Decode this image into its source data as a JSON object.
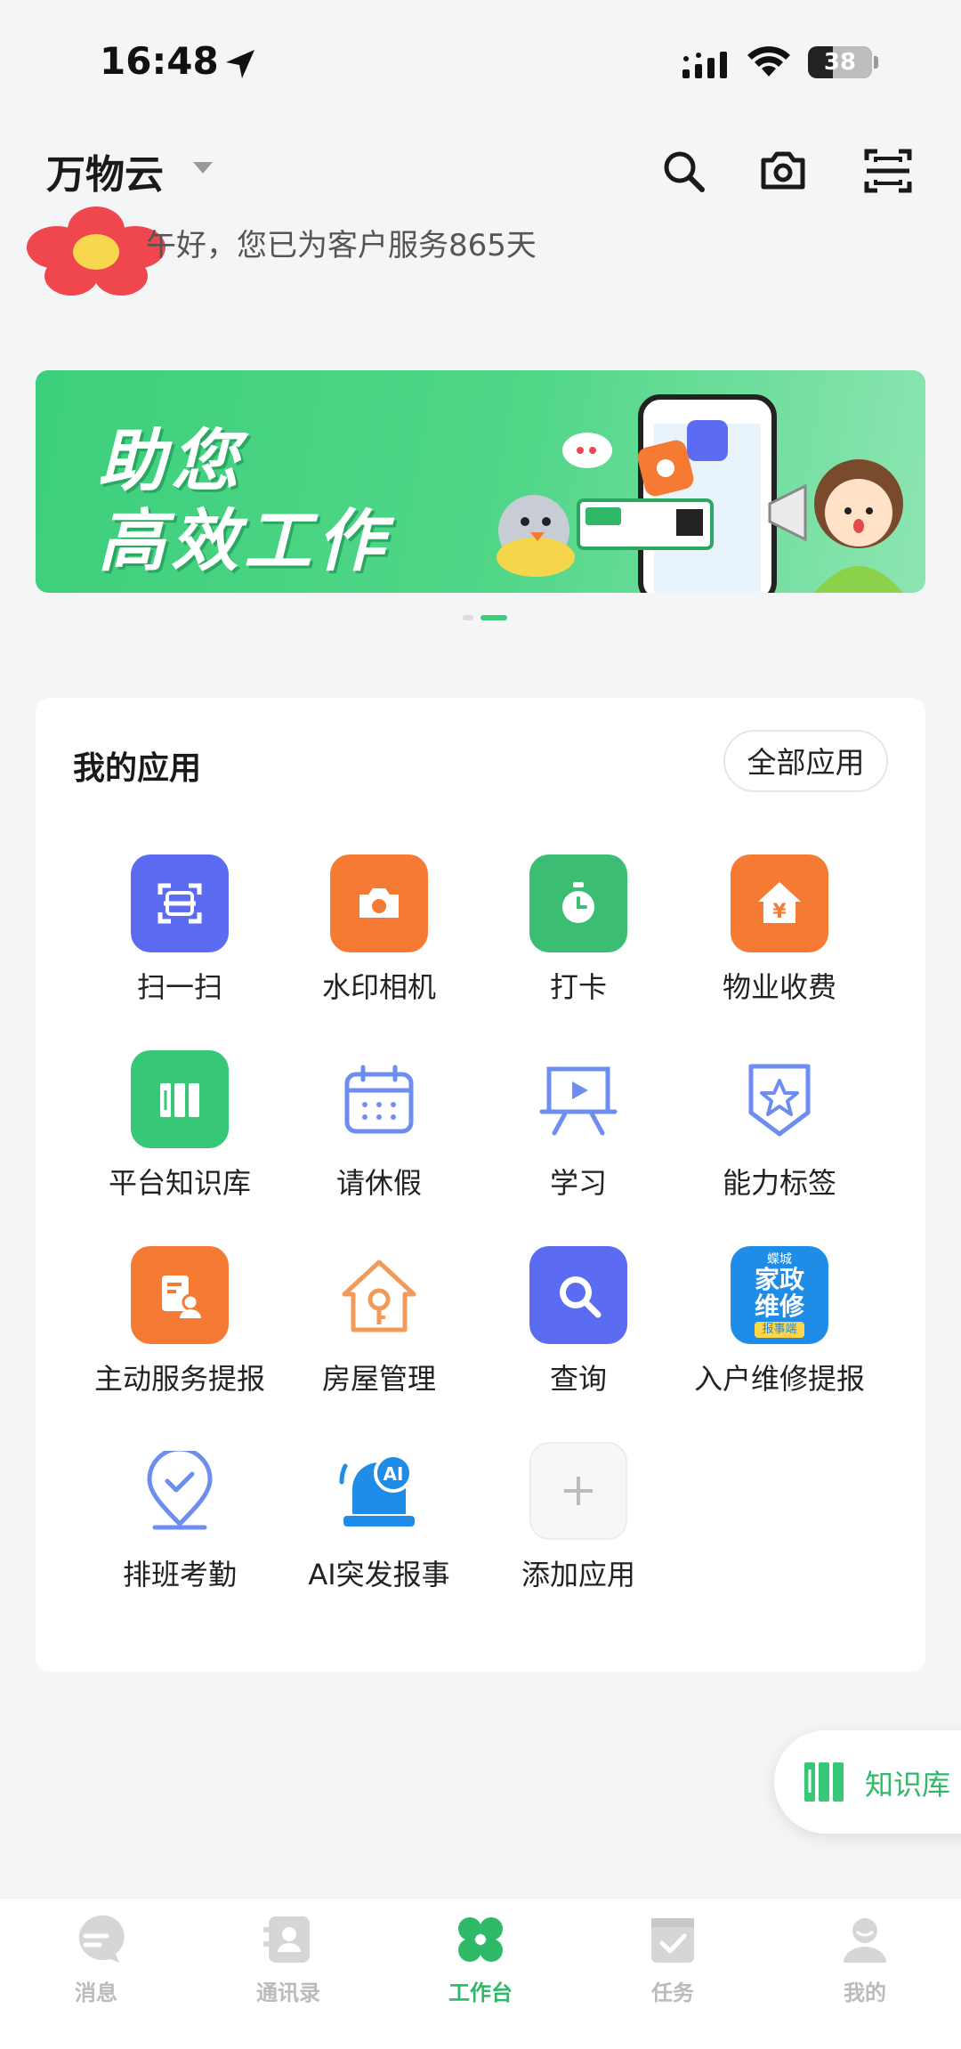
{
  "status_bar": {
    "time": "16:48",
    "battery": "38",
    "icons": [
      "location-arrow-icon",
      "signal-icon",
      "wifi-icon",
      "battery-icon"
    ]
  },
  "header": {
    "org_name": "万物云",
    "greeting": "午好，您已为客户服务865天",
    "icons": [
      "search-icon",
      "camera-icon",
      "scan-icon"
    ]
  },
  "banner": {
    "line1": "助您",
    "line2": "高效工作",
    "page_count": 2,
    "active_page": 2
  },
  "apps": {
    "title": "我的应用",
    "all_apps_label": "全部应用",
    "items": [
      {
        "label": "扫一扫",
        "icon": "scan-icon",
        "color": "#5b6cf2"
      },
      {
        "label": "水印相机",
        "icon": "camera-icon",
        "color": "#f57a33"
      },
      {
        "label": "打卡",
        "icon": "stopwatch-icon",
        "color": "#3cbd74"
      },
      {
        "label": "物业收费",
        "icon": "house-yen-icon",
        "color": "#f57a33"
      },
      {
        "label": "平台知识库",
        "icon": "books-icon",
        "color": "#36c777"
      },
      {
        "label": "请休假",
        "icon": "calendar-icon",
        "color": "#6d8ef0"
      },
      {
        "label": "学习",
        "icon": "presentation-board-icon",
        "color": "#6d8ef0"
      },
      {
        "label": "能力标签",
        "icon": "badge-star-icon",
        "color": "#6d8ef0"
      },
      {
        "label": "主动服务提报",
        "icon": "report-person-icon",
        "color": "#f57a33"
      },
      {
        "label": "房屋管理",
        "icon": "house-key-icon",
        "color": "#f19a5a"
      },
      {
        "label": "查询",
        "icon": "magnifier-icon",
        "color": "#5b6cf2"
      },
      {
        "label": "入户维修提报",
        "icon": "home-repair-icon",
        "color": "#1f8de8"
      },
      {
        "label": "排班考勤",
        "icon": "location-check-icon",
        "color": "#6d8ef0"
      },
      {
        "label": "AI突发报事",
        "icon": "ai-alarm-bell-icon",
        "color": "#1f8de8"
      },
      {
        "label": "添加应用",
        "icon": "plus-icon",
        "color": "#bbbbbb"
      }
    ],
    "home_repair_badge": {
      "top": "蝶城",
      "main1": "家政",
      "main2": "维修",
      "bottom": "报事端"
    }
  },
  "floating_button": {
    "label": "知识库",
    "icon": "books-icon"
  },
  "tabbar": {
    "active": "工作台",
    "items": [
      {
        "label": "消息",
        "icon": "chat-bubble-icon"
      },
      {
        "label": "通讯录",
        "icon": "contacts-icon"
      },
      {
        "label": "工作台",
        "icon": "clover-icon"
      },
      {
        "label": "任务",
        "icon": "task-check-icon"
      },
      {
        "label": "我的",
        "icon": "person-icon"
      }
    ]
  },
  "colors": {
    "brand_green": "#2fb868",
    "banner_green": "#3ccf7b",
    "tab_inactive": "#bbbbbb"
  }
}
